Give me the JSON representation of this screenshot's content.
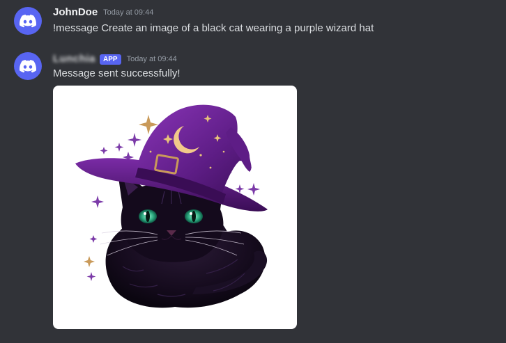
{
  "messages": [
    {
      "username": "JohnDoe",
      "timestamp": "Today at 09:44",
      "content": "!message Create an image of a black cat wearing a purple wizard hat",
      "avatar_icon": "discord-logo-icon"
    },
    {
      "username": "Lunchia",
      "badge": "APP",
      "timestamp": "Today at 09:44",
      "content": "Message sent successfully!",
      "avatar_icon": "discord-logo-icon",
      "attachment_icon": "black-cat-wizard-hat-image"
    }
  ],
  "colors": {
    "background": "#313338",
    "avatar": "#5865f2",
    "badge": "#5865f2",
    "username": "#f2f3f5",
    "message_text": "#dbdee1",
    "timestamp": "#949ba4"
  }
}
